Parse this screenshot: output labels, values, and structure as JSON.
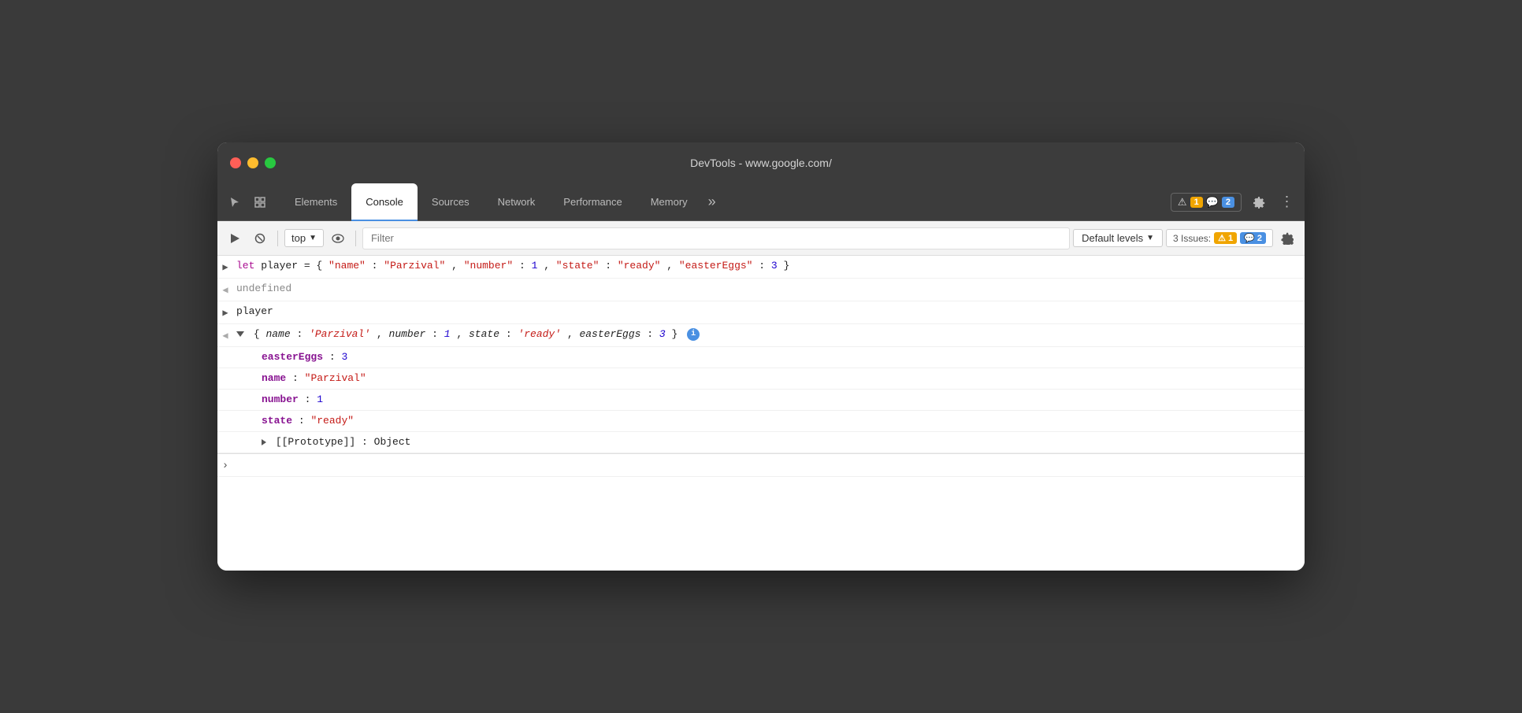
{
  "window": {
    "title": "DevTools - www.google.com/"
  },
  "tabs": {
    "items": [
      {
        "label": "Elements",
        "active": false
      },
      {
        "label": "Console",
        "active": true
      },
      {
        "label": "Sources",
        "active": false
      },
      {
        "label": "Network",
        "active": false
      },
      {
        "label": "Performance",
        "active": false
      },
      {
        "label": "Memory",
        "active": false
      }
    ],
    "more_label": "»"
  },
  "issues": {
    "label": "3 Issues:",
    "warning_count": "1",
    "info_count": "2"
  },
  "toolbar": {
    "context": "top",
    "filter_placeholder": "Filter",
    "levels_label": "Default levels"
  },
  "console": {
    "issues_label": "3 Issues:",
    "issues_warning": "⚠ 1",
    "issues_info": "💬 2",
    "lines": [
      {
        "type": "input",
        "content": "let player = { \"name\": \"Parzival\", \"number\": 1, \"state\": \"ready\", \"easterEggs\": 3 }"
      },
      {
        "type": "output",
        "content": "undefined"
      },
      {
        "type": "input-ref",
        "content": "player"
      },
      {
        "type": "object-collapsed",
        "content": "{name: 'Parzival', number: 1, state: 'ready', easterEggs: 3}"
      },
      {
        "type": "prop",
        "name": "easterEggs",
        "value": "3"
      },
      {
        "type": "prop",
        "name": "name",
        "value": "\"Parzival\""
      },
      {
        "type": "prop",
        "name": "number",
        "value": "1"
      },
      {
        "type": "prop",
        "name": "state",
        "value": "\"ready\""
      },
      {
        "type": "prototype",
        "value": "Object"
      }
    ],
    "input_prompt": ">"
  }
}
